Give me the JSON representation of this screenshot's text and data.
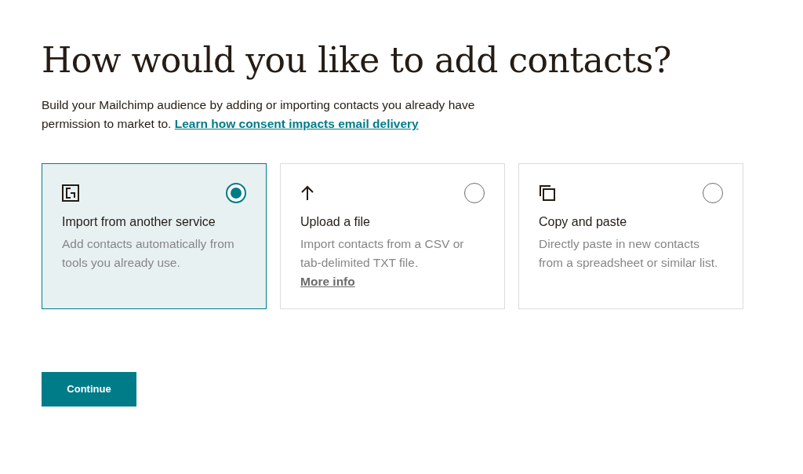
{
  "heading": "How would you like to add contacts?",
  "intro": {
    "text": "Build your Mailchimp audience by adding or importing contacts you already have permission to market to.",
    "link": "Learn how consent impacts email delivery"
  },
  "options": [
    {
      "kind": "import",
      "title": "Import from another service",
      "description": "Add contacts automatically from tools you already use.",
      "selected": true
    },
    {
      "kind": "upload",
      "title": "Upload a file",
      "description": "Import contacts from a CSV or tab-delimited TXT file.",
      "link": "More info",
      "selected": false
    },
    {
      "kind": "paste",
      "title": "Copy and paste",
      "description": "Directly paste in new contacts from a spreadsheet or similar list.",
      "selected": false
    }
  ],
  "continue_button": "Continue"
}
